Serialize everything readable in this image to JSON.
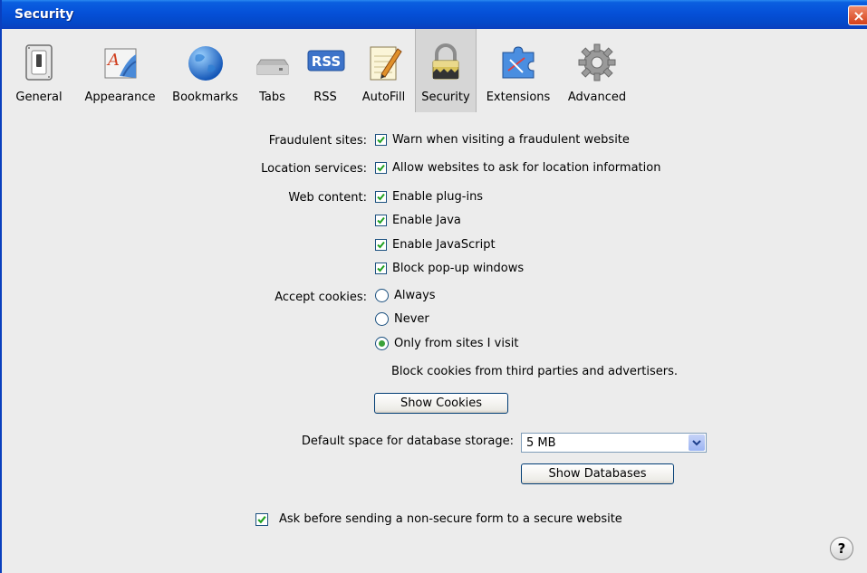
{
  "window": {
    "title": "Security",
    "close_label": "×"
  },
  "toolbar": {
    "tabs": [
      {
        "label": "General",
        "icon": "switch-icon"
      },
      {
        "label": "Appearance",
        "icon": "appearance-icon"
      },
      {
        "label": "Bookmarks",
        "icon": "globe-icon"
      },
      {
        "label": "Tabs",
        "icon": "tabs-icon"
      },
      {
        "label": "RSS",
        "icon": "rss-icon",
        "badge": "RSS"
      },
      {
        "label": "AutoFill",
        "icon": "pencil-notepad-icon"
      },
      {
        "label": "Security",
        "icon": "padlock-icon",
        "active": true
      },
      {
        "label": "Extensions",
        "icon": "puzzle-icon"
      },
      {
        "label": "Advanced",
        "icon": "gear-icon"
      }
    ]
  },
  "security": {
    "fraudulent": {
      "label": "Fraudulent sites:",
      "option": "Warn when visiting a fraudulent website",
      "checked": true
    },
    "location": {
      "label": "Location services:",
      "option": "Allow websites to ask for location information",
      "checked": true
    },
    "web_content": {
      "label": "Web content:",
      "options": [
        {
          "label": "Enable plug-ins",
          "checked": true
        },
        {
          "label": "Enable Java",
          "checked": true
        },
        {
          "label": "Enable JavaScript",
          "checked": true
        },
        {
          "label": "Block pop-up windows",
          "checked": true
        }
      ]
    },
    "cookies": {
      "label": "Accept cookies:",
      "options": [
        {
          "label": "Always",
          "selected": false
        },
        {
          "label": "Never",
          "selected": false
        },
        {
          "label": "Only from sites I visit",
          "selected": true
        }
      ],
      "note": "Block cookies from third parties and advertisers.",
      "show_button": "Show Cookies"
    },
    "database": {
      "label": "Default space for database storage:",
      "value": "5 MB",
      "show_button": "Show Databases"
    },
    "nonsecure": {
      "option": "Ask before sending a non-secure form to a secure website",
      "checked": true
    },
    "help_label": "?"
  }
}
